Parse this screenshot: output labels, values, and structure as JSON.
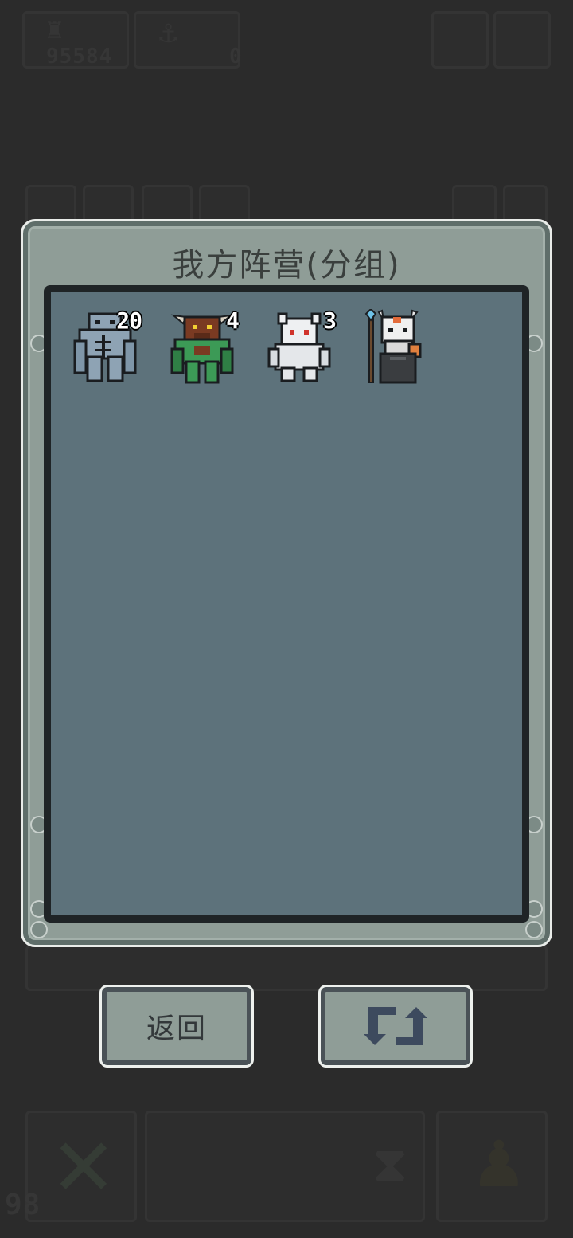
{
  "hud": {
    "top_number_1": "95584",
    "top_number_2": "0",
    "bottom_number": "98"
  },
  "dialog": {
    "title": "我方阵营(分组)",
    "units": [
      {
        "name": "stone-golem",
        "count": "20"
      },
      {
        "name": "minotaur",
        "count": "4"
      },
      {
        "name": "ghost",
        "count": "3"
      },
      {
        "name": "skeleton-mage",
        "count": ""
      }
    ]
  },
  "buttons": {
    "back_label": "返回",
    "swap_icon": "swap-arrows-icon"
  },
  "colors": {
    "panel": "#8f9d97",
    "inner": "#5d727b",
    "background": "#2b2b2b"
  }
}
